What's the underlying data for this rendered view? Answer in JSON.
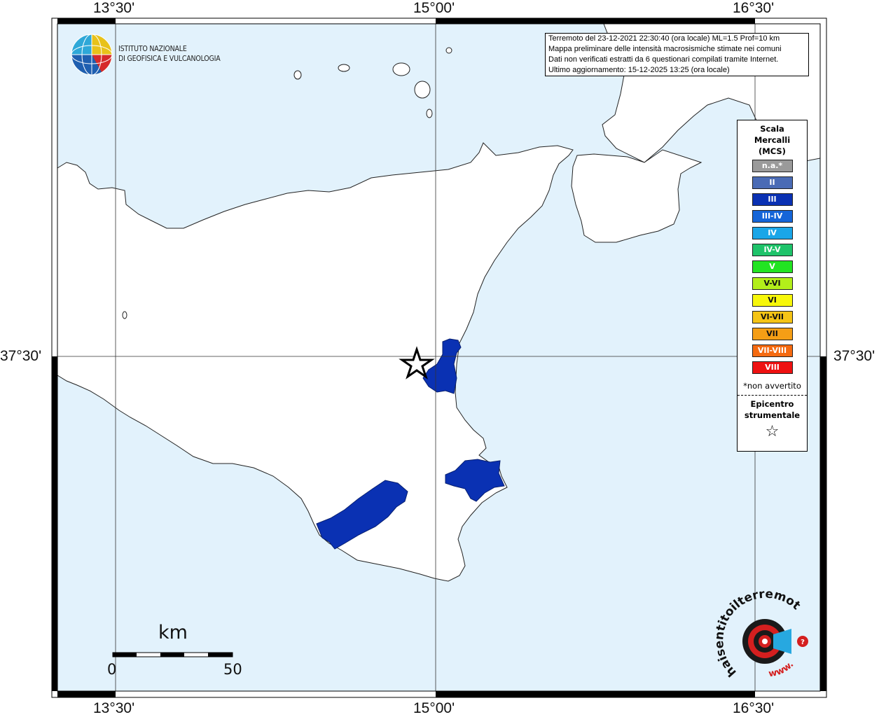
{
  "map": {
    "coords": {
      "top": [
        "13°30'",
        "15°00'",
        "16°30'"
      ],
      "bottom": [
        "13°30'",
        "15°00'",
        "16°30'"
      ],
      "left": "37°30'",
      "right": "37°30'"
    },
    "colors": {
      "sea": "#e2f2fc",
      "land": "#ffffff",
      "felt_area": "#0a31b3",
      "frame": "#000000"
    },
    "felt_intensity": "III"
  },
  "ingv": {
    "line1": "ISTITUTO NAZIONALE",
    "line2": "DI GEOFISICA E VULCANOLOGIA",
    "icon": "ingv-globe-logo"
  },
  "info": {
    "line1": "Terremoto del 23-12-2021 22:30:40 (ora locale) ML=1.5 Prof=10 km",
    "line2": "Mappa preliminare delle intensità macrosismiche stimate nei comuni",
    "line3": "Dati non verificati estratti da 6 questionari compilati tramite Internet.",
    "line4": "Ultimo aggiornamento: 15-12-2025 13:25 (ora locale)"
  },
  "legend": {
    "title1": "Scala",
    "title2": "Mercalli",
    "title3": "(MCS)",
    "items": [
      {
        "label": "n.a.*",
        "color": "#9a9a9a"
      },
      {
        "label": "II",
        "color": "#4a6bb5"
      },
      {
        "label": "III",
        "color": "#0a31b3"
      },
      {
        "label": "III-IV",
        "color": "#1565d8"
      },
      {
        "label": "IV",
        "color": "#1aa6e8"
      },
      {
        "label": "IV-V",
        "color": "#1ec36a"
      },
      {
        "label": "V",
        "color": "#22e422"
      },
      {
        "label": "V-VI",
        "color": "#b3ef1a"
      },
      {
        "label": "VI",
        "color": "#f7f70a"
      },
      {
        "label": "VI-VII",
        "color": "#f5c415"
      },
      {
        "label": "VII",
        "color": "#f59e15"
      },
      {
        "label": "VII-VIII",
        "color": "#f56a10"
      },
      {
        "label": "VIII",
        "color": "#ee1111"
      }
    ],
    "note": "*non avvertito",
    "epicenter1": "Epicentro",
    "epicenter2": "strumentale",
    "epicenter_icon": "star-icon"
  },
  "scale": {
    "unit": "km",
    "start": "0",
    "end": "50"
  },
  "watermark": {
    "text_top": "haisentitoilterremoto.it",
    "text_bottom": "www.",
    "icon": "haisentito-logo"
  }
}
